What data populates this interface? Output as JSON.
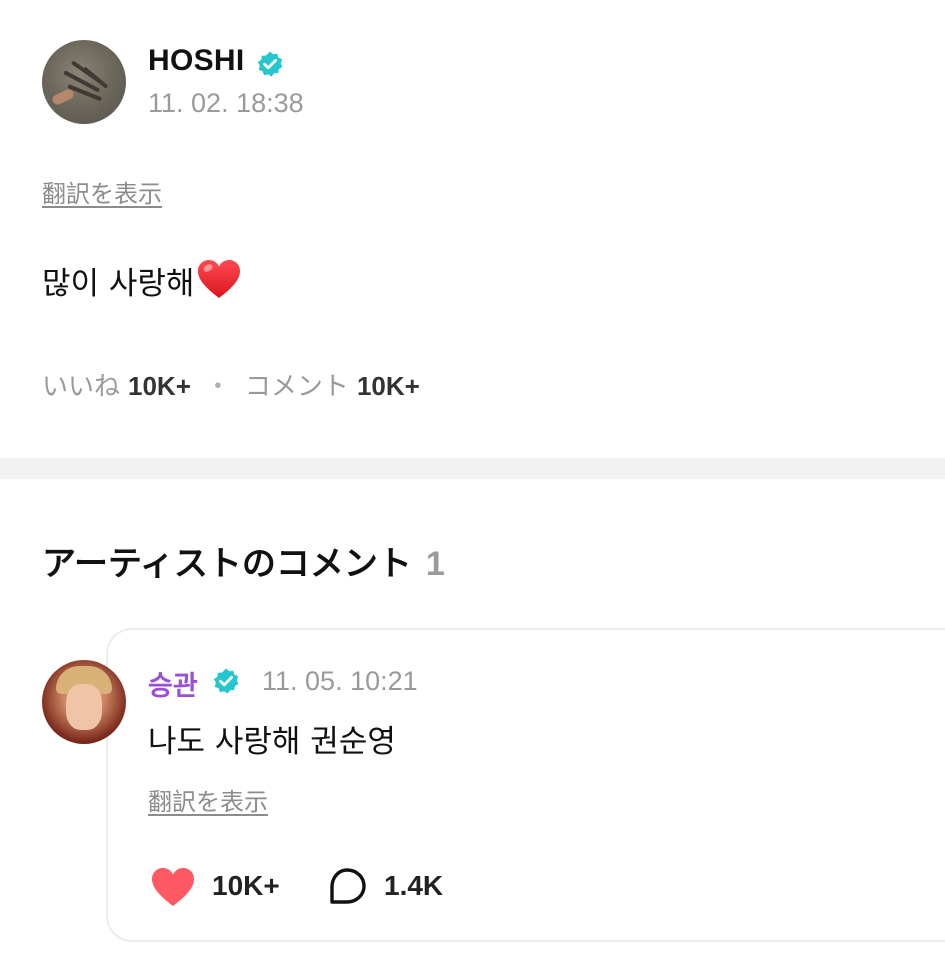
{
  "post": {
    "author": "HOSHI",
    "avatar_icon": "artist-profile-avatar",
    "verified_icon": "verified-badge-icon",
    "time": "11. 02. 18:38",
    "translate_label": "翻訳を表示",
    "body_text": "많이 사랑해",
    "body_emoji": "red-heart-emoji",
    "likes_label": "いいね",
    "likes_count": "10K+",
    "separator": "・",
    "comments_label": "コメント",
    "comments_count": "10K+"
  },
  "artist_comments": {
    "title": "アーティストのコメント",
    "count": "1",
    "items": [
      {
        "author": "승관",
        "avatar_icon": "artist-profile-avatar",
        "verified_icon": "verified-badge-icon",
        "time": "11. 05. 10:21",
        "body": "나도 사랑해 권순영",
        "translate_label": "翻訳を表示",
        "like_icon": "heart-icon",
        "like_count": "10K+",
        "reply_icon": "speech-bubble-icon",
        "reply_count": "1.4K"
      }
    ]
  },
  "colors": {
    "verified": "#25C6CE",
    "commenter_name": "#9B4FD6",
    "like_heart": "#FF5A64",
    "muted_text": "#9A9A9A",
    "divider": "#F2F2F2"
  }
}
